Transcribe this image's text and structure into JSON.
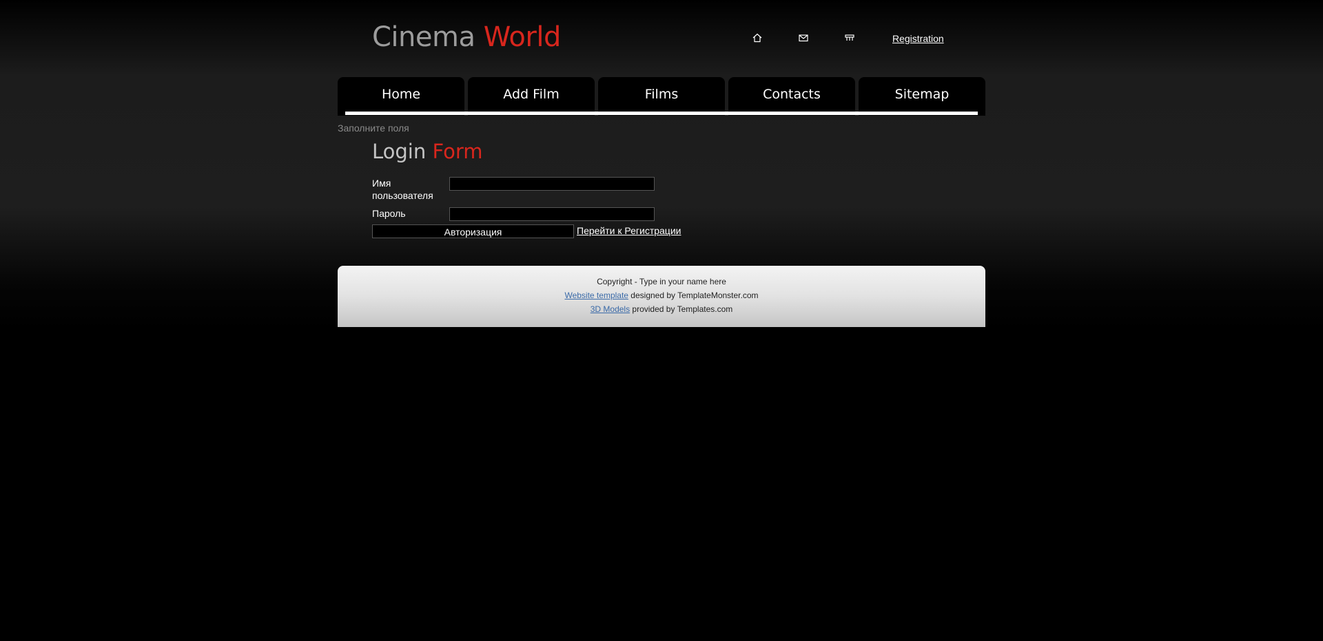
{
  "header": {
    "logo_word1": "Cinema",
    "logo_word2": "World",
    "icons": [
      "home-icon",
      "mail-icon",
      "sitemap-icon"
    ],
    "registration_link": "Registration"
  },
  "nav": {
    "items": [
      {
        "label": "Home"
      },
      {
        "label": "Add Film"
      },
      {
        "label": "Films"
      },
      {
        "label": "Contacts"
      },
      {
        "label": "Sitemap"
      }
    ]
  },
  "main": {
    "hint": "Заполните поля",
    "title_word1": "Login",
    "title_word2": "Form",
    "username_label": "Имя пользователя",
    "username_value": "",
    "password_label": "Пароль",
    "password_value": "",
    "submit_label": "Авторизация",
    "goto_registration": "Перейти к Регистрации"
  },
  "footer": {
    "copyright": "Copyright - Type in your name here",
    "template_link": "Website template",
    "template_suffix": " designed by TemplateMonster.com",
    "models_link": "3D Models",
    "models_suffix": " provided by Templates.com"
  },
  "colors": {
    "accent": "#d8261d",
    "logo_gray": "#9c9c9c",
    "background": "#000000",
    "footer_link": "#3a6aa8"
  }
}
